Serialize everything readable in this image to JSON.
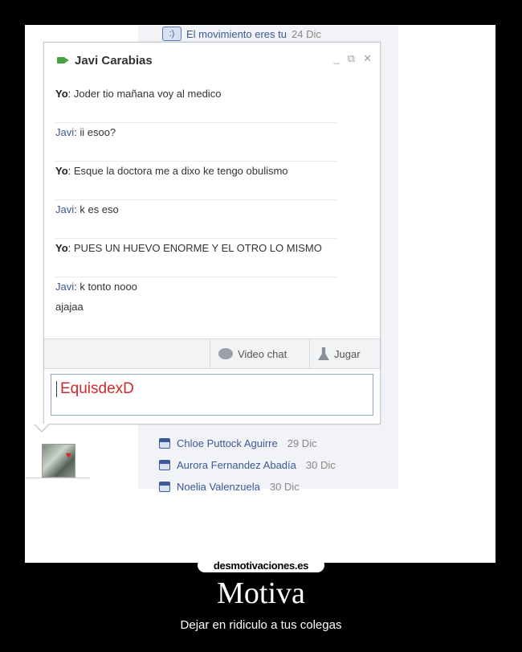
{
  "top_notification": {
    "text": "El movimiento eres tu",
    "date": "24 Dic",
    "icon": ":)"
  },
  "chat": {
    "title": "Javi Carabias",
    "controls": [
      "_",
      "⧉",
      "✕"
    ],
    "messages": [
      {
        "who": "Yo",
        "text": ": Joder tio mañana voy al medico"
      },
      {
        "who": "Javi",
        "text": ": ii esoo?"
      },
      {
        "who": "Yo",
        "text": ": Esque la doctora me a dixo ke tengo obulismo"
      },
      {
        "who": "Javi",
        "text": ": k es eso"
      },
      {
        "who": "Yo",
        "text": ": PUES UN HUEVO ENORME Y EL OTRO LO MISMO"
      },
      {
        "who": "Javi",
        "text": ": k tonto nooo",
        "extra": "ajajaa"
      }
    ],
    "toolbar": {
      "video_label": "Video chat",
      "game_label": "Jugar"
    },
    "input_value": "EquisdexD"
  },
  "friends": [
    {
      "name": "Chloe Puttock Aguirre",
      "date": "29 Dic"
    },
    {
      "name": "Aurora Fernandez Abadía",
      "date": "30 Dic"
    },
    {
      "name": "Noelia Valenzuela",
      "date": "30 Dic"
    }
  ],
  "poster": {
    "site": "desmotivaciones.es",
    "title": "Motiva",
    "subtitle": "Dejar en ridiculo a tus colegas"
  }
}
